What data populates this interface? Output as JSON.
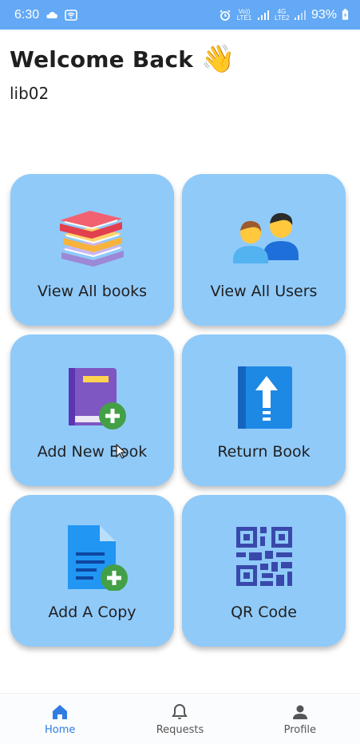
{
  "status_bar": {
    "time": "6:30",
    "network_label_1": "Vo)) LTE1",
    "network_label_2": "4G LTE2",
    "battery": "93%"
  },
  "header": {
    "title": "Welcome Back",
    "wave_emoji": "👋",
    "username": "lib02"
  },
  "cards": [
    {
      "label": "View All books",
      "icon": "book-stack-icon"
    },
    {
      "label": "View All Users",
      "icon": "users-icon"
    },
    {
      "label": "Add New Book",
      "icon": "add-book-icon"
    },
    {
      "label": "Return Book",
      "icon": "return-book-icon"
    },
    {
      "label": "Add A Copy",
      "icon": "add-document-icon"
    },
    {
      "label": "QR Code",
      "icon": "qr-code-icon"
    }
  ],
  "bottom_nav": {
    "items": [
      {
        "label": "Home",
        "icon": "home-icon",
        "active": true
      },
      {
        "label": "Requests",
        "icon": "bell-icon",
        "active": false
      },
      {
        "label": "Profile",
        "icon": "person-icon",
        "active": false
      }
    ]
  },
  "colors": {
    "status_bar": "#63a9f5",
    "card": "#90caf9",
    "nav_active": "#2f7de1"
  }
}
